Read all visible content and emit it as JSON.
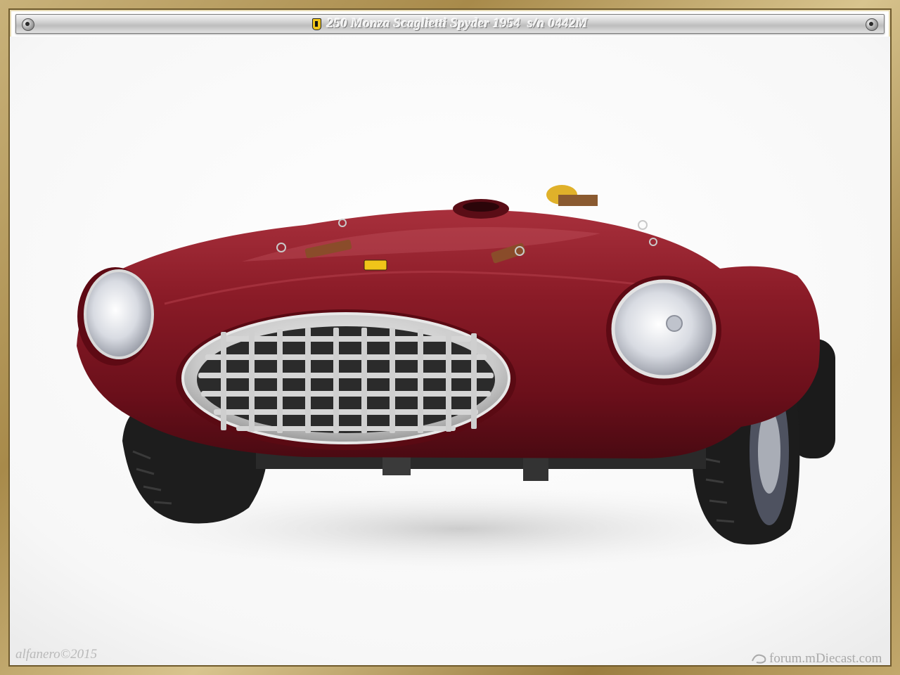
{
  "header": {
    "title": "250 Monza Scaglietti Spyder 1954  s/n 0442M",
    "emblem_icon": "prancing-horse-shield-icon"
  },
  "photo": {
    "subject": "car-photo",
    "body_color": "#7a1420",
    "grille_color": "#c8c8c8",
    "background_color": "#ffffff"
  },
  "footer": {
    "signature": "alfanero©2015",
    "watermark": "forum.mDiecast.com"
  },
  "colors": {
    "frame": "#b49a5c",
    "title_bar": "#cfcfcf"
  }
}
